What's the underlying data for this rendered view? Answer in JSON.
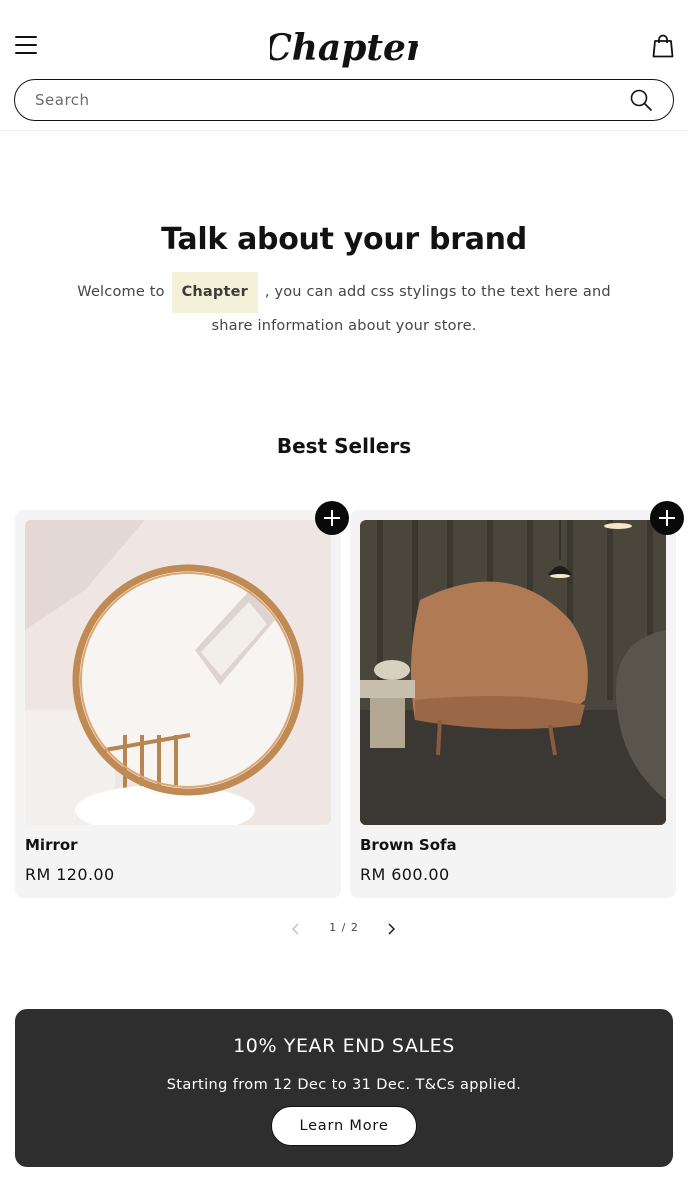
{
  "header": {
    "logo_text": "Chapter",
    "search_placeholder": "Search"
  },
  "brand": {
    "title": "Talk about your brand",
    "text_before": "Welcome to",
    "highlight": "Chapter",
    "text_after": ", you can add css stylings to the text here and share information about your store."
  },
  "best_sellers": {
    "title": "Best Sellers",
    "products": [
      {
        "name": "Mirror",
        "price": "RM 120.00",
        "image": "round-mirror"
      },
      {
        "name": "Brown Sofa",
        "price": "RM 600.00",
        "image": "brown-sofa"
      }
    ],
    "pager": {
      "current": 1,
      "total": 2,
      "label": "1 / 2"
    }
  },
  "promo": {
    "title": "10% YEAR END SALES",
    "text": "Starting from 12 Dec to 31 Dec. T&Cs applied.",
    "button_label": "Learn More"
  },
  "colors": {
    "text": "#121212",
    "highlight_bg": "#f3f1d8",
    "card_bg": "#f4f4f4",
    "promo_bg": "#2e2e2e",
    "accent_black": "#0a0a0a"
  }
}
